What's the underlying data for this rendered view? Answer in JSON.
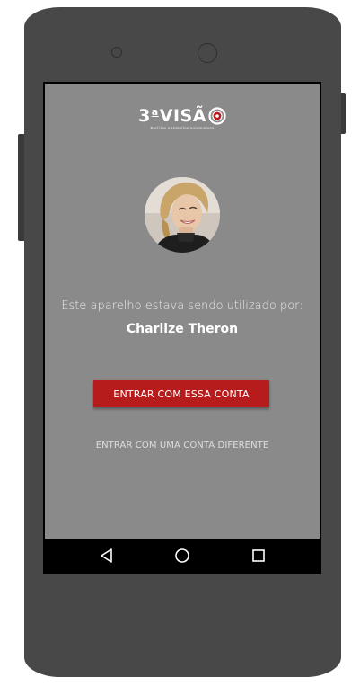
{
  "device": {
    "frame_color": "#484848",
    "screen_bg": "#8a8a8a"
  },
  "logo": {
    "text_prefix": "3",
    "text_sup": "a",
    "text_main": "VIS",
    "text_accent": "Ã",
    "tagline": "Perícias e Histórias Automotivas",
    "accent_color": "#b71c1c"
  },
  "account": {
    "prompt": "Este aparelho estava sendo utilizado por:",
    "user_name": "Charlize Theron",
    "avatar_icon": "user-photo"
  },
  "actions": {
    "primary_label": "ENTRAR COM ESSA CONTA",
    "primary_color": "#b71c1c",
    "secondary_label": "ENTRAR COM UMA CONTA DIFERENTE"
  },
  "navbar": {
    "back_icon": "back-triangle-icon",
    "home_icon": "home-circle-icon",
    "recents_icon": "recents-square-icon"
  }
}
